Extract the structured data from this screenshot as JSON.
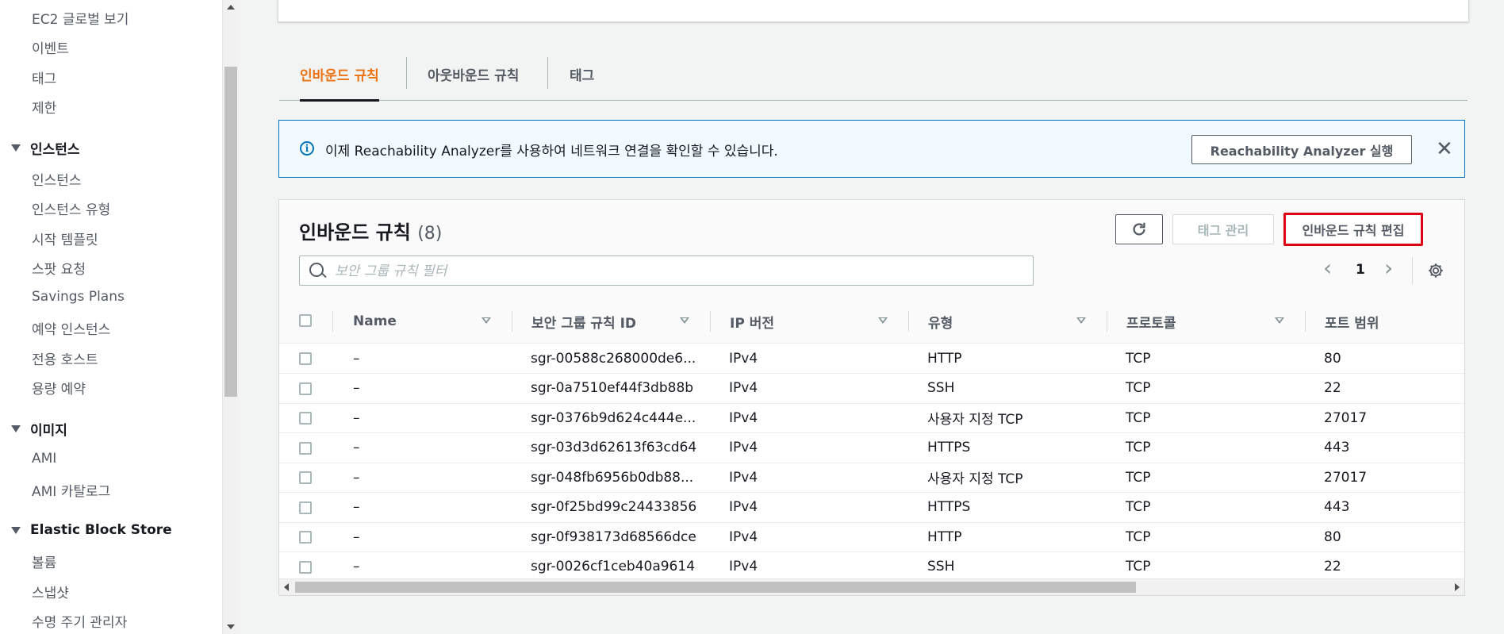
{
  "sidebar": {
    "items_top": [
      "EC2 글로벌 보기",
      "이벤트",
      "태그",
      "제한"
    ],
    "sections": [
      {
        "title": "인스턴스",
        "items": [
          "인스턴스",
          "인스턴스 유형",
          "시작 템플릿",
          "스팟 요청",
          "Savings Plans",
          "예약 인스턴스",
          "전용 호스트",
          "용량 예약"
        ]
      },
      {
        "title": "이미지",
        "items": [
          "AMI",
          "AMI 카탈로그"
        ]
      },
      {
        "title": "Elastic Block Store",
        "items": [
          "볼륨",
          "스냅샷",
          "수명 주기 관리자"
        ]
      }
    ]
  },
  "tabs": [
    "인바운드 규칙",
    "아웃바운드 규칙",
    "태그"
  ],
  "banner": {
    "message": "이제 Reachability Analyzer를 사용하여 네트워크 연결을 확인할 수 있습니다.",
    "button": "Reachability Analyzer 실행",
    "close": "✕"
  },
  "table": {
    "title": "인바운드 규칙",
    "count": "(8)",
    "manage_tags": "태그 관리",
    "edit_rules": "인바운드 규칙 편집",
    "search_placeholder": "보안 그룹 규칙 필터",
    "page": "1",
    "prev": "‹",
    "next": "›",
    "columns": [
      "Name",
      "보안 그룹 규칙 ID",
      "IP 버전",
      "유형",
      "프로토콜",
      "포트 범위"
    ],
    "rows": [
      [
        "–",
        "sgr-00588c268000de6...",
        "IPv4",
        "HTTP",
        "TCP",
        "80"
      ],
      [
        "–",
        "sgr-0a7510ef44f3db88b",
        "IPv4",
        "SSH",
        "TCP",
        "22"
      ],
      [
        "–",
        "sgr-0376b9d624c444e...",
        "IPv4",
        "사용자 지정 TCP",
        "TCP",
        "27017"
      ],
      [
        "–",
        "sgr-03d3d62613f63cd64",
        "IPv4",
        "HTTPS",
        "TCP",
        "443"
      ],
      [
        "–",
        "sgr-048fb6956b0db88...",
        "IPv4",
        "사용자 지정 TCP",
        "TCP",
        "27017"
      ],
      [
        "–",
        "sgr-0f25bd99c24433856",
        "IPv4",
        "HTTPS",
        "TCP",
        "443"
      ],
      [
        "–",
        "sgr-0f938173d68566dce",
        "IPv4",
        "HTTP",
        "TCP",
        "80"
      ],
      [
        "–",
        "sgr-0026cf1ceb40a9614",
        "IPv4",
        "SSH",
        "TCP",
        "22"
      ]
    ]
  },
  "colors": {
    "accent": "#ec7211",
    "info": "#0073bb",
    "highlight": "#e00016"
  }
}
